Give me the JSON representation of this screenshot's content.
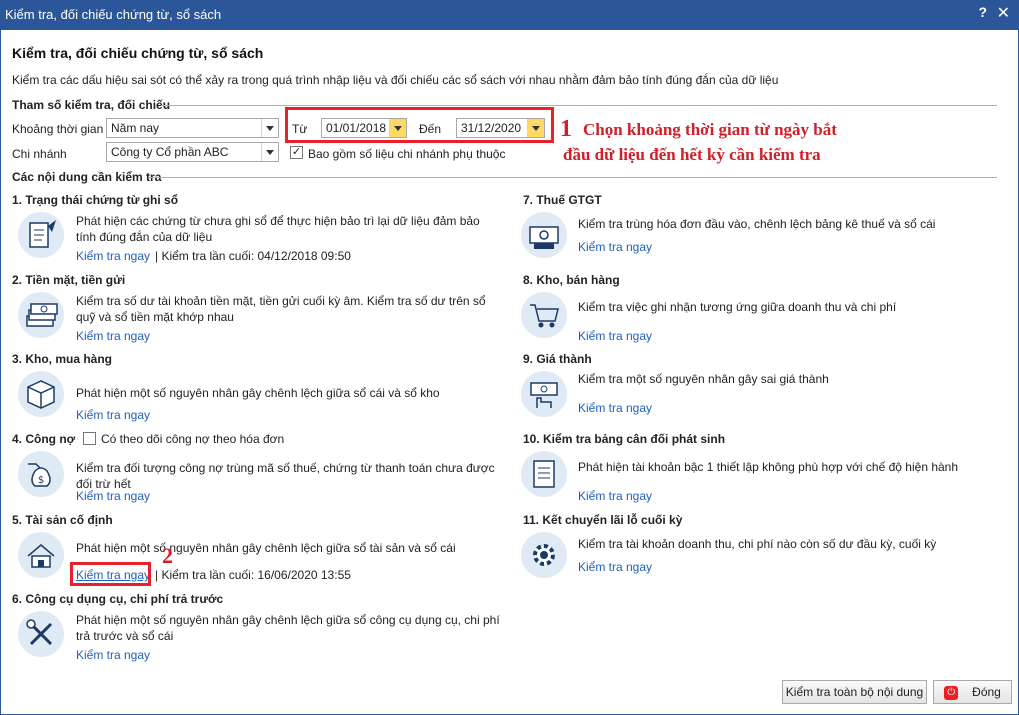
{
  "window": {
    "title": "Kiểm tra, đối chiếu chứng từ, sổ sách",
    "help": "?",
    "close": "✕"
  },
  "header": {
    "title": "Kiểm tra, đối chiếu chứng từ, sổ sách",
    "description": "Kiểm tra các dấu hiệu sai sót có thể xảy ra trong quá trình nhập liệu và đối chiếu các sổ sách với nhau nhằm đảm bảo tính đúng đắn của dữ liệu"
  },
  "params": {
    "section_title": "Tham số kiểm tra, đối chiếu",
    "period_label": "Khoảng thời gian",
    "period_value": "Năm nay",
    "from_label": "Từ",
    "from_value": "01/01/2018",
    "to_label": "Đến",
    "to_value": "31/12/2020",
    "branch_label": "Chi nhánh",
    "branch_value": "Công ty Cổ phần ABC",
    "include_branch_label": "Bao gồm số liệu chi nhánh phụ thuộc",
    "include_branch_checked": true
  },
  "annotation": {
    "num1": "1",
    "text1_line1": "Chọn khoảng thời gian từ ngày bắt",
    "text1_line2": "đầu dữ liệu đến hết kỳ cần kiểm tra",
    "num2": "2",
    "color": "#d01f27"
  },
  "content": {
    "section_title": "Các nội dung cần kiểm tra",
    "link_label": "Kiểm tra ngay",
    "items": [
      {
        "title": "1. Trạng thái chứng từ ghi sổ",
        "desc": "Phát hiện các chứng từ chưa ghi sổ để thực hiện bảo trì lại dữ liệu đảm bảo tính đúng đắn của dữ liệu",
        "last_check": "| Kiểm tra lần cuối: 04/12/2018 09:50",
        "icon": "document-quill-icon"
      },
      {
        "title": "2. Tiền mặt, tiền gửi",
        "desc": "Kiểm tra số dư tài khoản tiền mặt, tiền gửi cuối kỳ âm. Kiểm tra số dư trên sổ quỹ và sổ tiền mặt khớp nhau",
        "icon": "money-stack-icon"
      },
      {
        "title": "3. Kho, mua hàng",
        "desc": "Phát hiện một số nguyên nhân gây chênh lệch giữa sổ cái và sổ kho",
        "icon": "package-box-icon"
      },
      {
        "title": "4. Công nợ",
        "checkbox_label": "Có theo dõi công nợ theo hóa đơn",
        "desc": "Kiểm tra đối tượng công nợ trùng mã số thuế, chứng từ thanh toán chưa được đối trừ hết",
        "icon": "money-bag-hand-icon"
      },
      {
        "title": "5. Tài sản cố định",
        "desc": "Phát hiện một số nguyên nhân gây chênh lệch giữa sổ tài sản và sổ cái",
        "last_check": "| Kiểm tra lần cuối: 16/06/2020 13:55",
        "icon": "house-asset-icon"
      },
      {
        "title": "6. Công cụ dụng cụ, chi phí trả trước",
        "desc": "Phát hiện một số nguyên nhân gây chênh lệch giữa sổ công cụ dụng cụ, chi phí trả trước và sổ cái",
        "icon": "tools-icon"
      },
      {
        "title": "7. Thuế GTGT",
        "desc": "Kiểm tra trùng hóa đơn đầu vào, chênh lệch bảng kê thuế và sổ cái",
        "icon": "tax-invoice-icon"
      },
      {
        "title": "8. Kho, bán hàng",
        "desc": "Kiểm tra việc ghi nhận tương ứng giữa doanh thu và chi phí",
        "icon": "shopping-cart-icon"
      },
      {
        "title": "9. Giá thành",
        "desc": "Kiểm tra một số nguyên nhân gây sai giá thành",
        "icon": "hand-money-icon"
      },
      {
        "title": "10. Kiểm tra bảng cân đối phát sinh",
        "desc": "Phát hiện tài khoản bậc 1 thiết lập không phù hợp với chế độ hiện hành",
        "icon": "balance-sheet-icon"
      },
      {
        "title": "11. Kết chuyển lãi lỗ cuối kỳ",
        "desc": "Kiểm tra tài khoản doanh thu, chi phí nào còn số dư đầu kỳ, cuối kỳ",
        "icon": "gear-document-icon"
      }
    ]
  },
  "footer": {
    "check_all_label": "Kiểm tra toàn bộ nội dung",
    "close_label": "Đóng"
  },
  "colors": {
    "titlebar": "#2b579a",
    "link": "#1f5fbf",
    "highlight": "#e8202a"
  }
}
